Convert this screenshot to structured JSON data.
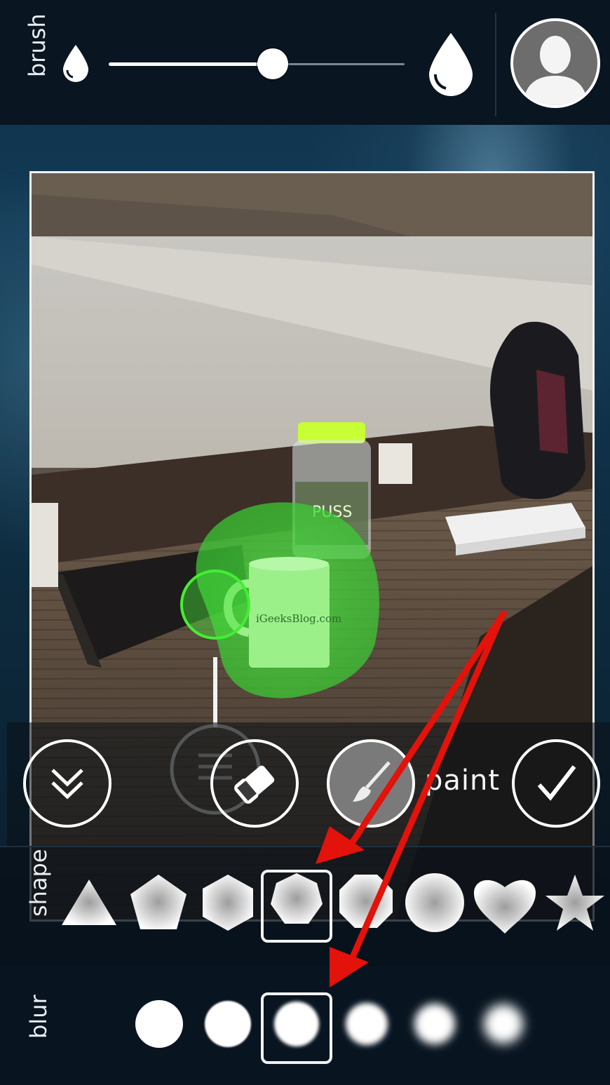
{
  "brush": {
    "label": "brush",
    "size_fraction": 0.54
  },
  "profile": {
    "icon": "user-silhouette-icon"
  },
  "photo": {
    "mug_text": "iGeeksBlog.com",
    "jar_label": "PUSS"
  },
  "controls": {
    "collapse_icon": "double-chevron-down-icon",
    "eraser_icon": "eraser-icon",
    "paint_icon": "paint-brush-icon",
    "paint_label": "paint",
    "confirm_icon": "checkmark-icon"
  },
  "shape": {
    "label": "shape",
    "options": [
      "triangle",
      "pentagon",
      "hexagon",
      "heptagon",
      "octagon",
      "circle",
      "heart",
      "star"
    ],
    "selected_index": 3
  },
  "blur": {
    "label": "blur",
    "levels": [
      0,
      1,
      2,
      3,
      4,
      5
    ],
    "selected_index": 2
  },
  "colors": {
    "mask_green": "#3ecb3a",
    "arrow_red": "#e3120b",
    "toolbar": "#091520"
  }
}
